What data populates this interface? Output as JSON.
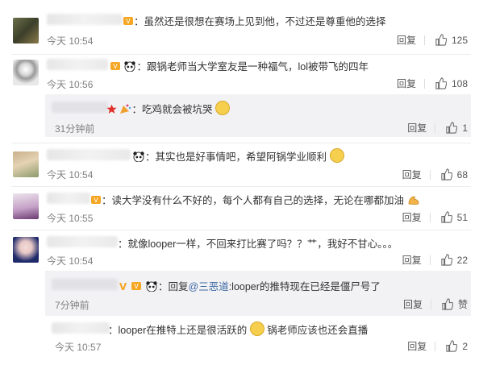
{
  "comments": [
    {
      "name_tail": "",
      "text": "虽然还是很想在赛场上见到他，不过还是尊重他的选择",
      "time": "今天 10:54",
      "reply": "回复",
      "likes": "125"
    },
    {
      "name_tail": "",
      "text": "跟锅老师当大学室友是一种福气，lol被带飞的四年",
      "time": "今天 10:56",
      "reply": "回复",
      "likes": "108"
    },
    {
      "name_tail": "",
      "text": "吃鸡就会被坑哭",
      "time": "31分钟前",
      "reply": "回复",
      "likes": "1"
    },
    {
      "name_tail": "",
      "text": "其实也是好事情吧，希望阿锅学业顺利",
      "time": "今天 10:54",
      "reply": "回复",
      "likes": "68"
    },
    {
      "name_tail": "",
      "text": "读大学没有什么不好的，每个人都有自己的选择，无论在哪都加油",
      "time": "今天 10:55",
      "reply": "回复",
      "likes": "51"
    },
    {
      "name_tail": "",
      "text": "就像looper一样，不回来打比赛了吗？？艹，我好不甘心。。。",
      "time": "今天 10:54",
      "reply": "回复",
      "likes": "22"
    },
    {
      "name_tail": "",
      "reply_prefix": "回复",
      "mention": "@三恶道",
      "text": ":looper的推特现在已经是僵尸号了",
      "time": "7分钟前",
      "reply": "回复",
      "likes": "赞"
    },
    {
      "name_tail": "",
      "text_a": "looper在推特上还是很活跃的",
      "text_b": "锅老师应该也还会直播",
      "time": "今天 10:57",
      "reply": "回复",
      "likes": "2"
    }
  ],
  "colors": {
    "link": "#3d6aa2",
    "meta": "#808080",
    "subbg": "#f2f2f5"
  }
}
